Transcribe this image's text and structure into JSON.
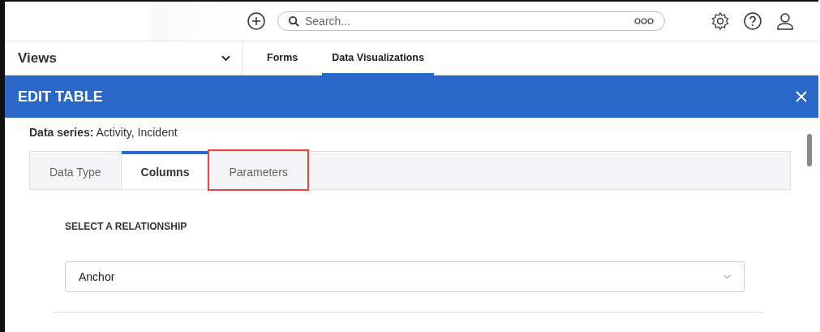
{
  "top_bar": {
    "search": {
      "placeholder": "Search..."
    }
  },
  "nav": {
    "views_label": "Views",
    "tabs": [
      {
        "label": "Forms",
        "selected": false
      },
      {
        "label": "Data Visualizations",
        "selected": true
      }
    ]
  },
  "dialog": {
    "title": "EDIT TABLE",
    "data_series": "**Data series:** Activity, Incident",
    "tabs": [
      {
        "label": "Data Type",
        "selected": false,
        "highlighted": false
      },
      {
        "label": "Columns",
        "selected": true,
        "highlighted": false
      },
      {
        "label": "Parameters",
        "selected": false,
        "highlighted": true
      }
    ],
    "section_label": "SELECT A RELATIONSHIP",
    "relationship": {
      "value": "Anchor"
    }
  }
}
